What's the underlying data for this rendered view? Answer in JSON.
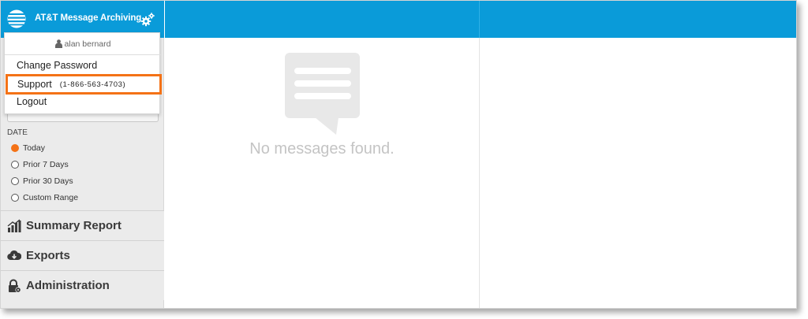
{
  "app": {
    "title": "AT&T Message Archiving",
    "logo_icon": "att-globe-icon",
    "settings_icon": "gear-icon",
    "brand_color": "#0a9bd9",
    "accent_color": "#f47216"
  },
  "user_menu": {
    "username": "alan bernard",
    "user_icon": "user-icon",
    "items": [
      {
        "label": "Change Password"
      },
      {
        "label": "Support",
        "phone": "(1-866-563-4703)",
        "highlighted": true
      },
      {
        "label": "Logout"
      }
    ]
  },
  "filters": {
    "date": {
      "label": "DATE",
      "options": [
        {
          "label": "Today",
          "selected": true
        },
        {
          "label": "Prior 7 Days",
          "selected": false
        },
        {
          "label": "Prior 30 Days",
          "selected": false
        },
        {
          "label": "Custom Range",
          "selected": false
        }
      ]
    }
  },
  "nav": [
    {
      "label": "Summary Report",
      "icon": "bar-chart-icon"
    },
    {
      "label": "Exports",
      "icon": "cloud-download-icon"
    },
    {
      "label": "Administration",
      "icon": "lock-gear-icon"
    }
  ],
  "main": {
    "empty_message": "No messages found.",
    "empty_icon": "message-bubble-icon"
  }
}
